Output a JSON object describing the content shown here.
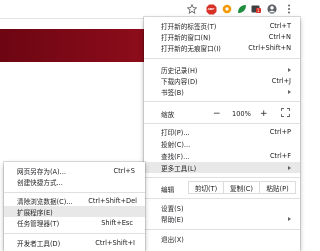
{
  "toolbar": {
    "star_icon": "star-icon",
    "extension_badge": "ABP",
    "badge_count": "1",
    "accent": "#d93025"
  },
  "main_menu": {
    "new_tab": {
      "label": "打开新的标签页(T)",
      "shortcut": "Ctrl+T"
    },
    "new_window": {
      "label": "打开新的窗口(N)",
      "shortcut": "Ctrl+N"
    },
    "incognito": {
      "label": "打开新的无痕窗口(I)",
      "shortcut": "Ctrl+Shift+N"
    },
    "history": {
      "label": "历史记录(H)"
    },
    "downloads": {
      "label": "下载内容(D)",
      "shortcut": "Ctrl+J"
    },
    "bookmarks": {
      "label": "书签(B)"
    },
    "zoom": {
      "label": "缩放",
      "minus": "−",
      "value": "100%",
      "plus": "+"
    },
    "print": {
      "label": "打印(P)...",
      "shortcut": "Ctrl+P"
    },
    "cast": {
      "label": "投射(C)..."
    },
    "find": {
      "label": "查找(F)...",
      "shortcut": "Ctrl+F"
    },
    "more_tools": {
      "label": "更多工具(L)"
    },
    "edit": {
      "label": "编辑",
      "cut": "剪切(T)",
      "copy": "复制(C)",
      "paste": "粘贴(P)"
    },
    "settings": {
      "label": "设置(S)"
    },
    "help": {
      "label": "帮助(E)"
    },
    "exit": {
      "label": "退出(X)"
    }
  },
  "sub_menu": {
    "save_page": {
      "label": "网页另存为(A)...",
      "shortcut": "Ctrl+S"
    },
    "create_shortcut": {
      "label": "创建快捷方式..."
    },
    "clear_data": {
      "label": "清除浏览数据(C)...",
      "shortcut": "Ctrl+Shift+Del"
    },
    "extensions": {
      "label": "扩展程序(E)"
    },
    "task_manager": {
      "label": "任务管理器(T)",
      "shortcut": "Shift+Esc"
    },
    "dev_tools": {
      "label": "开发者工具(D)",
      "shortcut": "Ctrl+Shift+I"
    }
  }
}
